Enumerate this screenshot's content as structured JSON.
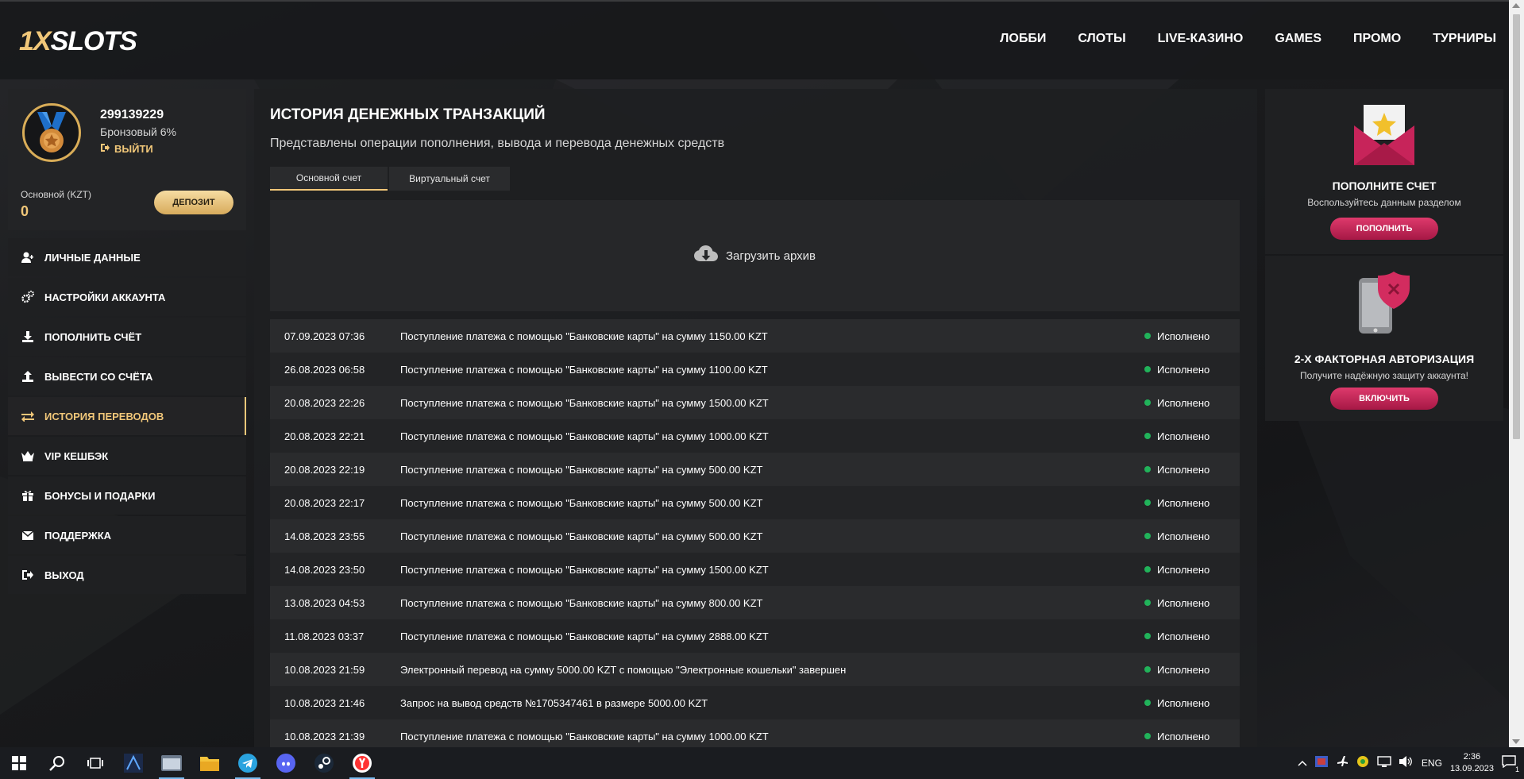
{
  "header": {
    "logo": "1XSLOTS",
    "nav": [
      "ЛОББИ",
      "СЛОТЫ",
      "LIVE-КАЗИНО",
      "GAMES",
      "ПРОМО",
      "ТУРНИРЫ"
    ]
  },
  "profile": {
    "user_id": "299139229",
    "level": "Бронзовый 6%",
    "logout": "ВЫЙТИ",
    "balance_label": "Основной (KZT)",
    "balance_value": "0",
    "deposit_button": "ДЕПОЗИТ"
  },
  "menu": [
    {
      "label": "ЛИЧНЫЕ ДАННЫЕ",
      "icon": "user-icon",
      "active": false
    },
    {
      "label": "НАСТРОЙКИ АККАУНТА",
      "icon": "gears-icon",
      "active": false
    },
    {
      "label": "ПОПОЛНИТЬ СЧЁТ",
      "icon": "download-icon",
      "active": false
    },
    {
      "label": "ВЫВЕСТИ СО СЧЁТА",
      "icon": "upload-icon",
      "active": false
    },
    {
      "label": "ИСТОРИЯ ПЕРЕВОДОВ",
      "icon": "transfer-icon",
      "active": true
    },
    {
      "label": "VIP КЕШБЭК",
      "icon": "crown-icon",
      "active": false
    },
    {
      "label": "БОНУСЫ И ПОДАРКИ",
      "icon": "gift-icon",
      "active": false
    },
    {
      "label": "ПОДДЕРЖКА",
      "icon": "mail-icon",
      "active": false
    },
    {
      "label": "ВЫХОД",
      "icon": "exit-icon",
      "active": false
    }
  ],
  "main": {
    "title": "ИСТОРИЯ ДЕНЕЖНЫХ ТРАНЗАКЦИЙ",
    "subtitle": "Представлены операции пополнения, вывода и перевода денежных средств",
    "tabs": [
      "Основной счет",
      "Виртуальный счет"
    ],
    "upload_label": "Загрузить архив",
    "transactions": [
      {
        "date": "07.09.2023 07:36",
        "desc": "Поступление платежа с помощью \"Банковские карты\" на сумму 1150.00 KZT",
        "status": "Исполнено"
      },
      {
        "date": "26.08.2023 06:58",
        "desc": "Поступление платежа с помощью \"Банковские карты\" на сумму 1100.00 KZT",
        "status": "Исполнено"
      },
      {
        "date": "20.08.2023 22:26",
        "desc": "Поступление платежа с помощью \"Банковские карты\" на сумму 1500.00 KZT",
        "status": "Исполнено"
      },
      {
        "date": "20.08.2023 22:21",
        "desc": "Поступление платежа с помощью \"Банковские карты\" на сумму 1000.00 KZT",
        "status": "Исполнено"
      },
      {
        "date": "20.08.2023 22:19",
        "desc": "Поступление платежа с помощью \"Банковские карты\" на сумму 500.00 KZT",
        "status": "Исполнено"
      },
      {
        "date": "20.08.2023 22:17",
        "desc": "Поступление платежа с помощью \"Банковские карты\" на сумму 500.00 KZT",
        "status": "Исполнено"
      },
      {
        "date": "14.08.2023 23:55",
        "desc": "Поступление платежа с помощью \"Банковские карты\" на сумму 500.00 KZT",
        "status": "Исполнено"
      },
      {
        "date": "14.08.2023 23:50",
        "desc": "Поступление платежа с помощью \"Банковские карты\" на сумму 1500.00 KZT",
        "status": "Исполнено"
      },
      {
        "date": "13.08.2023 04:53",
        "desc": "Поступление платежа с помощью \"Банковские карты\" на сумму 800.00 KZT",
        "status": "Исполнено"
      },
      {
        "date": "11.08.2023 03:37",
        "desc": "Поступление платежа с помощью \"Банковские карты\" на сумму 2888.00 KZT",
        "status": "Исполнено"
      },
      {
        "date": "10.08.2023 21:59",
        "desc": "Электронный перевод на сумму 5000.00 KZT с помощью \"Электронные кошельки\" завершен",
        "status": "Исполнено"
      },
      {
        "date": "10.08.2023 21:46",
        "desc": "Запрос на вывод средств №1705347461 в размере 5000.00 KZT",
        "status": "Исполнено"
      },
      {
        "date": "10.08.2023 21:39",
        "desc": "Поступление платежа с помощью \"Банковские карты\" на сумму 1000.00 KZT",
        "status": "Исполнено"
      }
    ]
  },
  "right": {
    "card1": {
      "title": "ПОПОЛНИТЕ СЧЕТ",
      "text": "Воспользуйтесь данным разделом",
      "button": "ПОПОЛНИТЬ"
    },
    "card2": {
      "title": "2-Х ФАКТОРНАЯ АВТОРИЗАЦИЯ",
      "text": "Получите надёжную защиту аккаунта!",
      "button": "ВКЛЮЧИТЬ"
    }
  },
  "taskbar": {
    "lang": "ENG",
    "time": "2:36",
    "date": "13.09.2023",
    "notification_count": "1"
  },
  "colors": {
    "accent": "#f1c779",
    "promo": "#c7245a",
    "success": "#21b35a"
  }
}
